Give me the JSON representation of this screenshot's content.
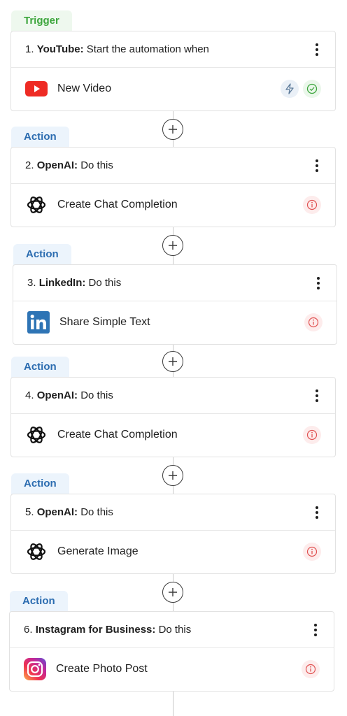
{
  "steps": [
    {
      "badge": "Trigger",
      "number": "1.",
      "app": "YouTube:",
      "action": "Start the automation when",
      "event": "New Video",
      "app_icon": "youtube-icon",
      "status": [
        "bolt-icon",
        "check-icon"
      ]
    },
    {
      "badge": "Action",
      "number": "2.",
      "app": "OpenAI:",
      "action": "Do this",
      "event": "Create Chat Completion",
      "app_icon": "openai-icon",
      "status": [
        "info-icon"
      ]
    },
    {
      "badge": "Action",
      "number": "3.",
      "app": "LinkedIn:",
      "action": "Do this",
      "event": "Share Simple Text",
      "app_icon": "linkedin-icon",
      "status": [
        "info-icon"
      ]
    },
    {
      "badge": "Action",
      "number": "4.",
      "app": "OpenAI:",
      "action": "Do this",
      "event": "Create Chat Completion",
      "app_icon": "openai-icon",
      "status": [
        "info-icon"
      ]
    },
    {
      "badge": "Action",
      "number": "5.",
      "app": "OpenAI:",
      "action": "Do this",
      "event": "Generate Image",
      "app_icon": "openai-icon",
      "status": [
        "info-icon"
      ]
    },
    {
      "badge": "Action",
      "number": "6.",
      "app": "Instagram for Business:",
      "action": "Do this",
      "event": "Create Photo Post",
      "app_icon": "instagram-icon",
      "status": [
        "info-icon"
      ]
    }
  ],
  "colors": {
    "trigger_text": "#3da63d",
    "action_text": "#2b6cb0",
    "error": "#e05252",
    "success": "#3da63d",
    "youtube": "#ee2b24",
    "linkedin": "#2e74b5"
  }
}
